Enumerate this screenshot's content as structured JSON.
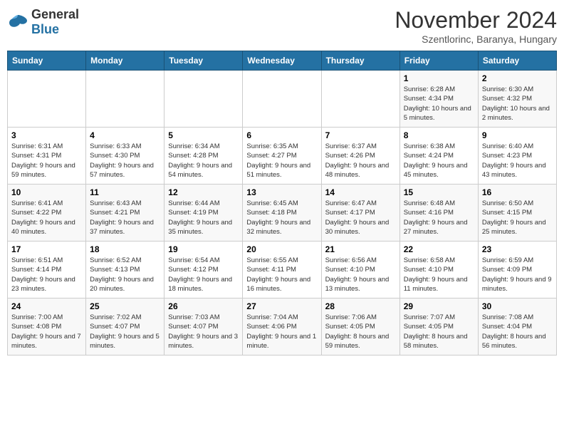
{
  "logo": {
    "general": "General",
    "blue": "Blue"
  },
  "header": {
    "month": "November 2024",
    "location": "Szentlorinc, Baranya, Hungary"
  },
  "weekdays": [
    "Sunday",
    "Monday",
    "Tuesday",
    "Wednesday",
    "Thursday",
    "Friday",
    "Saturday"
  ],
  "weeks": [
    [
      {
        "day": "",
        "info": ""
      },
      {
        "day": "",
        "info": ""
      },
      {
        "day": "",
        "info": ""
      },
      {
        "day": "",
        "info": ""
      },
      {
        "day": "",
        "info": ""
      },
      {
        "day": "1",
        "info": "Sunrise: 6:28 AM\nSunset: 4:34 PM\nDaylight: 10 hours and 5 minutes."
      },
      {
        "day": "2",
        "info": "Sunrise: 6:30 AM\nSunset: 4:32 PM\nDaylight: 10 hours and 2 minutes."
      }
    ],
    [
      {
        "day": "3",
        "info": "Sunrise: 6:31 AM\nSunset: 4:31 PM\nDaylight: 9 hours and 59 minutes."
      },
      {
        "day": "4",
        "info": "Sunrise: 6:33 AM\nSunset: 4:30 PM\nDaylight: 9 hours and 57 minutes."
      },
      {
        "day": "5",
        "info": "Sunrise: 6:34 AM\nSunset: 4:28 PM\nDaylight: 9 hours and 54 minutes."
      },
      {
        "day": "6",
        "info": "Sunrise: 6:35 AM\nSunset: 4:27 PM\nDaylight: 9 hours and 51 minutes."
      },
      {
        "day": "7",
        "info": "Sunrise: 6:37 AM\nSunset: 4:26 PM\nDaylight: 9 hours and 48 minutes."
      },
      {
        "day": "8",
        "info": "Sunrise: 6:38 AM\nSunset: 4:24 PM\nDaylight: 9 hours and 45 minutes."
      },
      {
        "day": "9",
        "info": "Sunrise: 6:40 AM\nSunset: 4:23 PM\nDaylight: 9 hours and 43 minutes."
      }
    ],
    [
      {
        "day": "10",
        "info": "Sunrise: 6:41 AM\nSunset: 4:22 PM\nDaylight: 9 hours and 40 minutes."
      },
      {
        "day": "11",
        "info": "Sunrise: 6:43 AM\nSunset: 4:21 PM\nDaylight: 9 hours and 37 minutes."
      },
      {
        "day": "12",
        "info": "Sunrise: 6:44 AM\nSunset: 4:19 PM\nDaylight: 9 hours and 35 minutes."
      },
      {
        "day": "13",
        "info": "Sunrise: 6:45 AM\nSunset: 4:18 PM\nDaylight: 9 hours and 32 minutes."
      },
      {
        "day": "14",
        "info": "Sunrise: 6:47 AM\nSunset: 4:17 PM\nDaylight: 9 hours and 30 minutes."
      },
      {
        "day": "15",
        "info": "Sunrise: 6:48 AM\nSunset: 4:16 PM\nDaylight: 9 hours and 27 minutes."
      },
      {
        "day": "16",
        "info": "Sunrise: 6:50 AM\nSunset: 4:15 PM\nDaylight: 9 hours and 25 minutes."
      }
    ],
    [
      {
        "day": "17",
        "info": "Sunrise: 6:51 AM\nSunset: 4:14 PM\nDaylight: 9 hours and 23 minutes."
      },
      {
        "day": "18",
        "info": "Sunrise: 6:52 AM\nSunset: 4:13 PM\nDaylight: 9 hours and 20 minutes."
      },
      {
        "day": "19",
        "info": "Sunrise: 6:54 AM\nSunset: 4:12 PM\nDaylight: 9 hours and 18 minutes."
      },
      {
        "day": "20",
        "info": "Sunrise: 6:55 AM\nSunset: 4:11 PM\nDaylight: 9 hours and 16 minutes."
      },
      {
        "day": "21",
        "info": "Sunrise: 6:56 AM\nSunset: 4:10 PM\nDaylight: 9 hours and 13 minutes."
      },
      {
        "day": "22",
        "info": "Sunrise: 6:58 AM\nSunset: 4:10 PM\nDaylight: 9 hours and 11 minutes."
      },
      {
        "day": "23",
        "info": "Sunrise: 6:59 AM\nSunset: 4:09 PM\nDaylight: 9 hours and 9 minutes."
      }
    ],
    [
      {
        "day": "24",
        "info": "Sunrise: 7:00 AM\nSunset: 4:08 PM\nDaylight: 9 hours and 7 minutes."
      },
      {
        "day": "25",
        "info": "Sunrise: 7:02 AM\nSunset: 4:07 PM\nDaylight: 9 hours and 5 minutes."
      },
      {
        "day": "26",
        "info": "Sunrise: 7:03 AM\nSunset: 4:07 PM\nDaylight: 9 hours and 3 minutes."
      },
      {
        "day": "27",
        "info": "Sunrise: 7:04 AM\nSunset: 4:06 PM\nDaylight: 9 hours and 1 minute."
      },
      {
        "day": "28",
        "info": "Sunrise: 7:06 AM\nSunset: 4:05 PM\nDaylight: 8 hours and 59 minutes."
      },
      {
        "day": "29",
        "info": "Sunrise: 7:07 AM\nSunset: 4:05 PM\nDaylight: 8 hours and 58 minutes."
      },
      {
        "day": "30",
        "info": "Sunrise: 7:08 AM\nSunset: 4:04 PM\nDaylight: 8 hours and 56 minutes."
      }
    ]
  ]
}
